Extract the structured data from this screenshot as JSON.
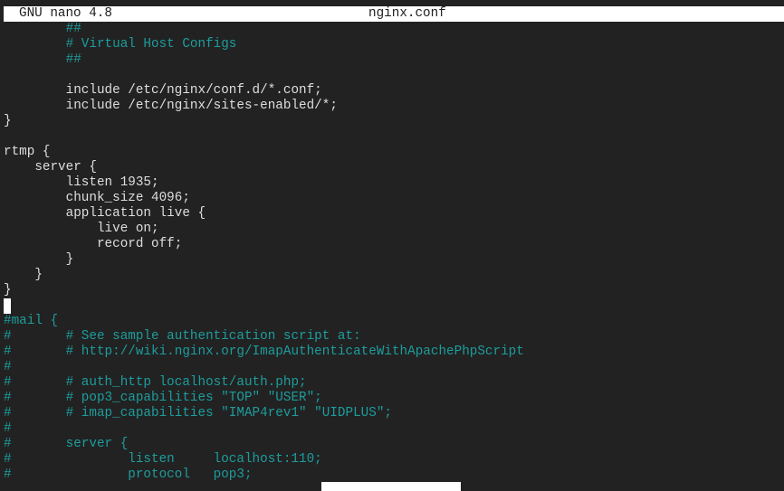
{
  "titlebar": {
    "app": "GNU nano 4.8",
    "filename": "nginx.conf"
  },
  "colors": {
    "background": "#222222",
    "text": "#dedede",
    "comment": "#1e9c9c",
    "titlebar_bg": "#ffffff"
  },
  "lines": [
    {
      "text": "        ##",
      "kind": "comment"
    },
    {
      "text": "        # Virtual Host Configs",
      "kind": "comment"
    },
    {
      "text": "        ##",
      "kind": "comment"
    },
    {
      "text": "",
      "kind": "code"
    },
    {
      "text": "        include /etc/nginx/conf.d/*.conf;",
      "kind": "code"
    },
    {
      "text": "        include /etc/nginx/sites-enabled/*;",
      "kind": "code"
    },
    {
      "text": "}",
      "kind": "code"
    },
    {
      "text": "",
      "kind": "code"
    },
    {
      "text": "rtmp {",
      "kind": "code"
    },
    {
      "text": "    server {",
      "kind": "code"
    },
    {
      "text": "        listen 1935;",
      "kind": "code"
    },
    {
      "text": "        chunk_size 4096;",
      "kind": "code"
    },
    {
      "text": "        application live {",
      "kind": "code"
    },
    {
      "text": "            live on;",
      "kind": "code"
    },
    {
      "text": "            record off;",
      "kind": "code"
    },
    {
      "text": "        }",
      "kind": "code"
    },
    {
      "text": "    }",
      "kind": "code"
    },
    {
      "text": "}",
      "kind": "code"
    },
    {
      "text": "",
      "kind": "cursor"
    },
    {
      "text": "#mail {",
      "kind": "comment"
    },
    {
      "text": "#       # See sample authentication script at:",
      "kind": "comment"
    },
    {
      "text": "#       # http://wiki.nginx.org/ImapAuthenticateWithApachePhpScript",
      "kind": "comment"
    },
    {
      "text": "#",
      "kind": "comment"
    },
    {
      "text": "#       # auth_http localhost/auth.php;",
      "kind": "comment"
    },
    {
      "text": "#       # pop3_capabilities \"TOP\" \"USER\";",
      "kind": "comment"
    },
    {
      "text": "#       # imap_capabilities \"IMAP4rev1\" \"UIDPLUS\";",
      "kind": "comment"
    },
    {
      "text": "#",
      "kind": "comment"
    },
    {
      "text": "#       server {",
      "kind": "comment"
    },
    {
      "text": "#               listen     localhost:110;",
      "kind": "comment"
    },
    {
      "text": "#               protocol   pop3;",
      "kind": "comment"
    }
  ]
}
